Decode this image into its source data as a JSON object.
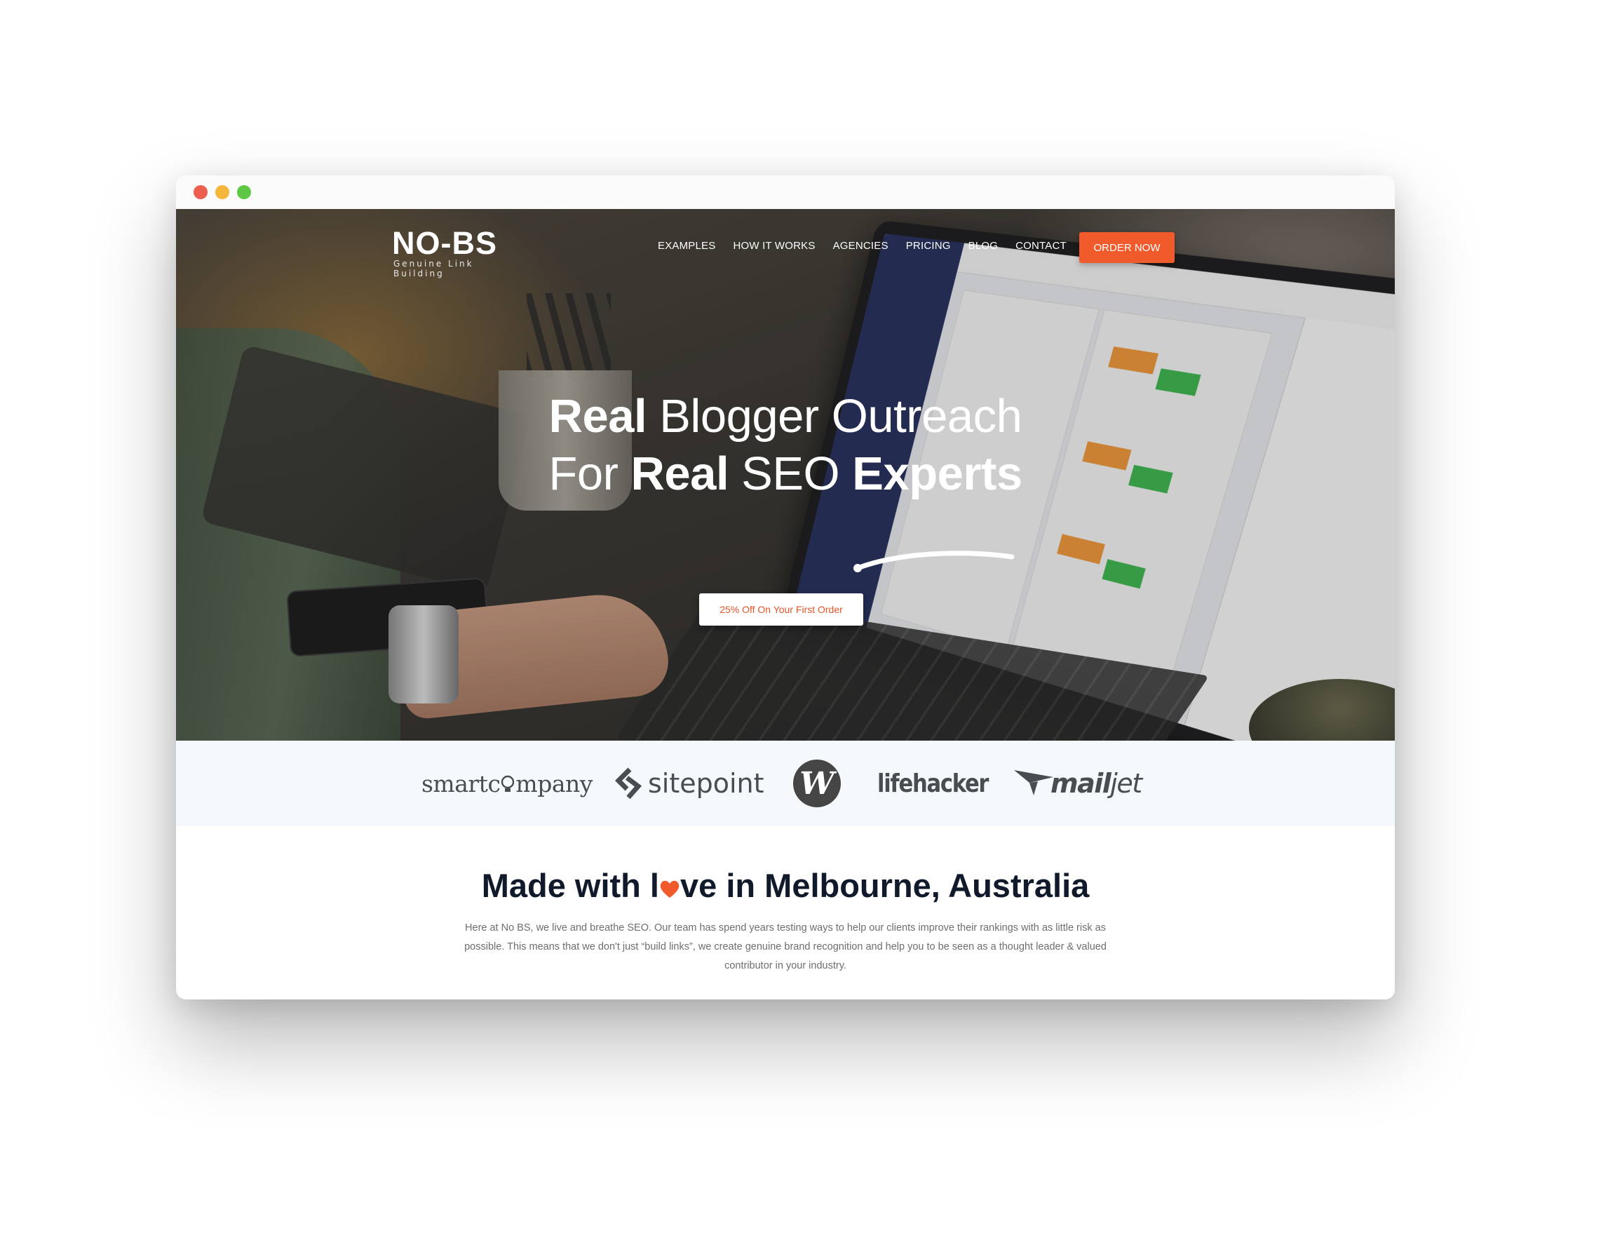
{
  "window": {
    "controls": [
      "close",
      "minimize",
      "maximize"
    ]
  },
  "header": {
    "logo_text": "NO-BS",
    "logo_tagline": "Genuine Link Building",
    "nav": [
      {
        "label": "EXAMPLES"
      },
      {
        "label": "HOW IT WORKS"
      },
      {
        "label": "AGENCIES"
      },
      {
        "label": "PRICING"
      },
      {
        "label": "BLOG"
      },
      {
        "label": "CONTACT"
      }
    ],
    "order_button": "ORDER NOW"
  },
  "hero": {
    "line1_bold": "Real",
    "line1_rest": " Blogger Outreach",
    "line2_pre": "For ",
    "line2_bold1": "Real",
    "line2_mid": " SEO ",
    "line2_bold2": "Experts",
    "cta": "25% Off On Your First Order"
  },
  "press": {
    "logos": [
      "smartcompany",
      "sitepoint",
      "w",
      "lifehacker",
      "mailjet"
    ],
    "smartcompany_pre": "smartc",
    "smartcompany_post": "mpany",
    "sitepoint": "sitepoint",
    "w_letter": "W",
    "lifehacker": "lifehacker",
    "mailjet_mail": "mail",
    "mailjet_jet": "jet"
  },
  "about": {
    "title_pre": "Made with l",
    "title_post": "ve in Melbourne, Australia",
    "body": "Here at No BS, we live and breathe SEO. Our team has spend years testing ways to help our clients improve their rankings with as little risk as possible. This means that we don't just “build links”, we create genuine brand recognition and help you to be seen as a thought leader & valued contributor in your industry."
  },
  "colors": {
    "accent": "#f15a2b",
    "heading": "#111a2b",
    "body_text": "#6b6e73",
    "press_bg": "#f5f9fb"
  },
  "icons": {
    "heart": "heart-icon",
    "sitepoint_mark": "sitepoint-chevron-icon",
    "mailjet_plane": "paper-plane-icon"
  }
}
